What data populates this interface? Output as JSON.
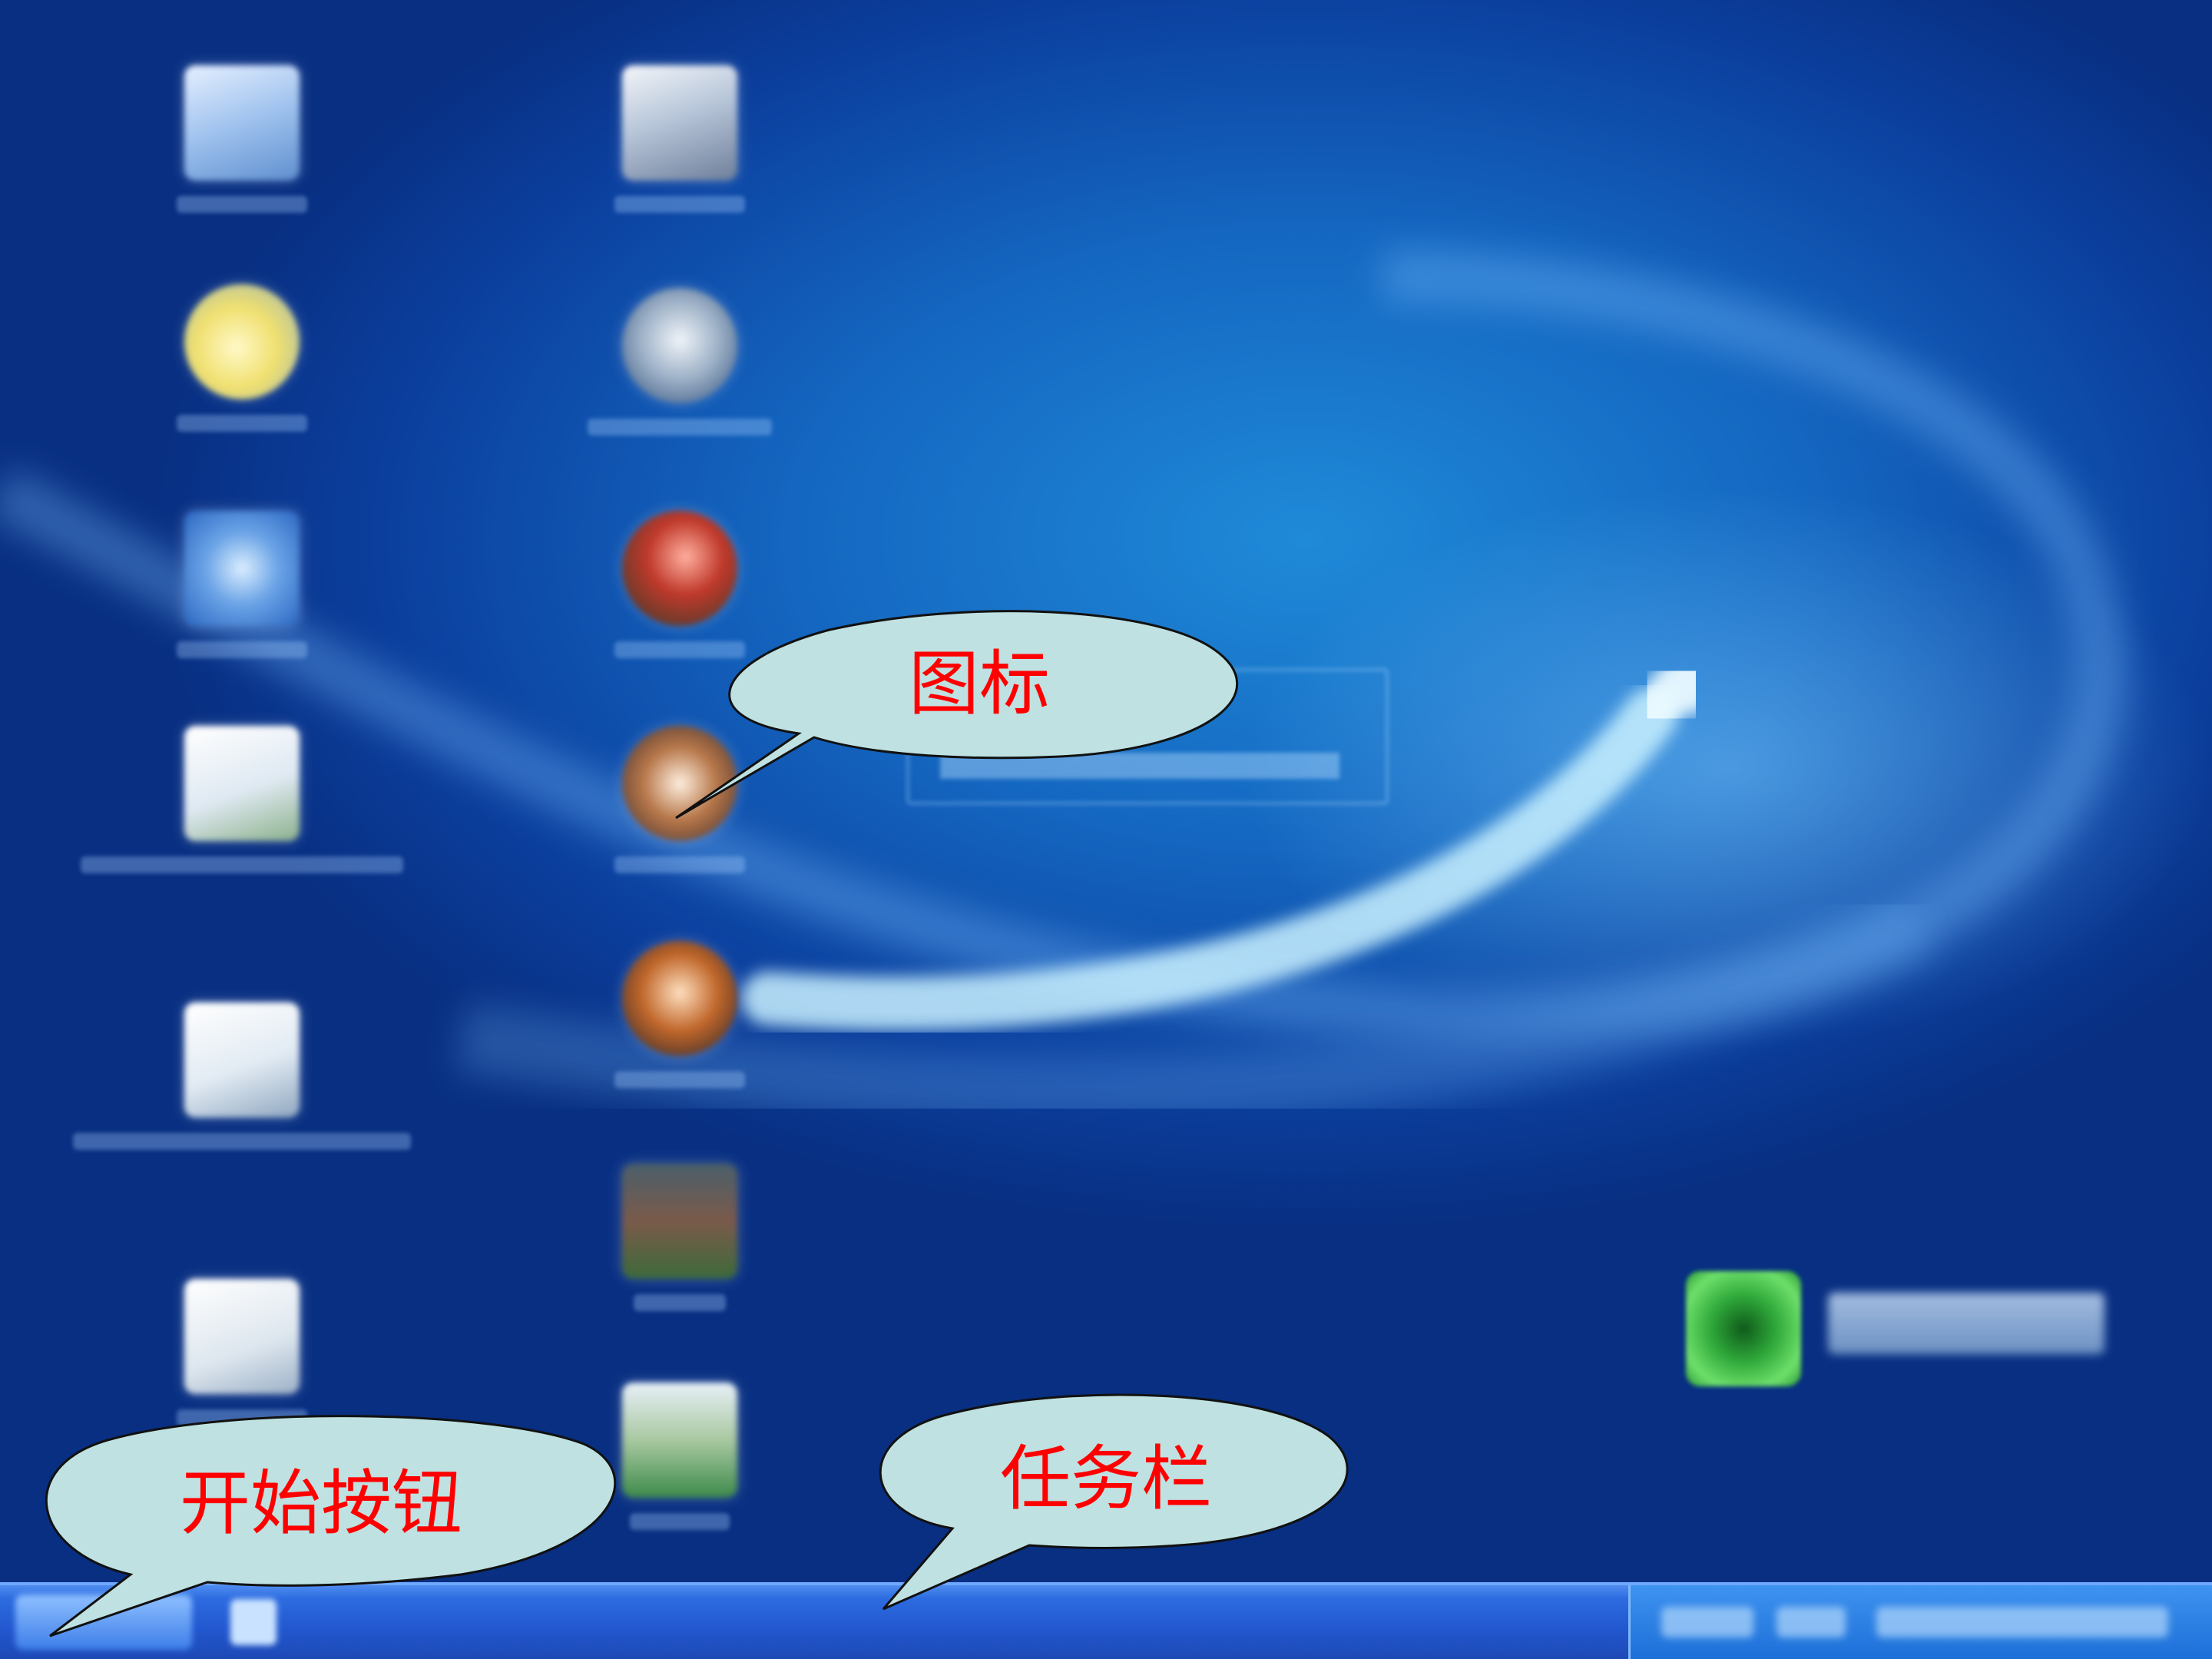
{
  "callouts": {
    "icon_label": "图标",
    "start_button_label": "开始按钮",
    "taskbar_label": "任务栏"
  },
  "colors": {
    "callout_fill": "#bfe1e1",
    "callout_text": "#ff0000",
    "desktop_blue": "#1466c0"
  }
}
